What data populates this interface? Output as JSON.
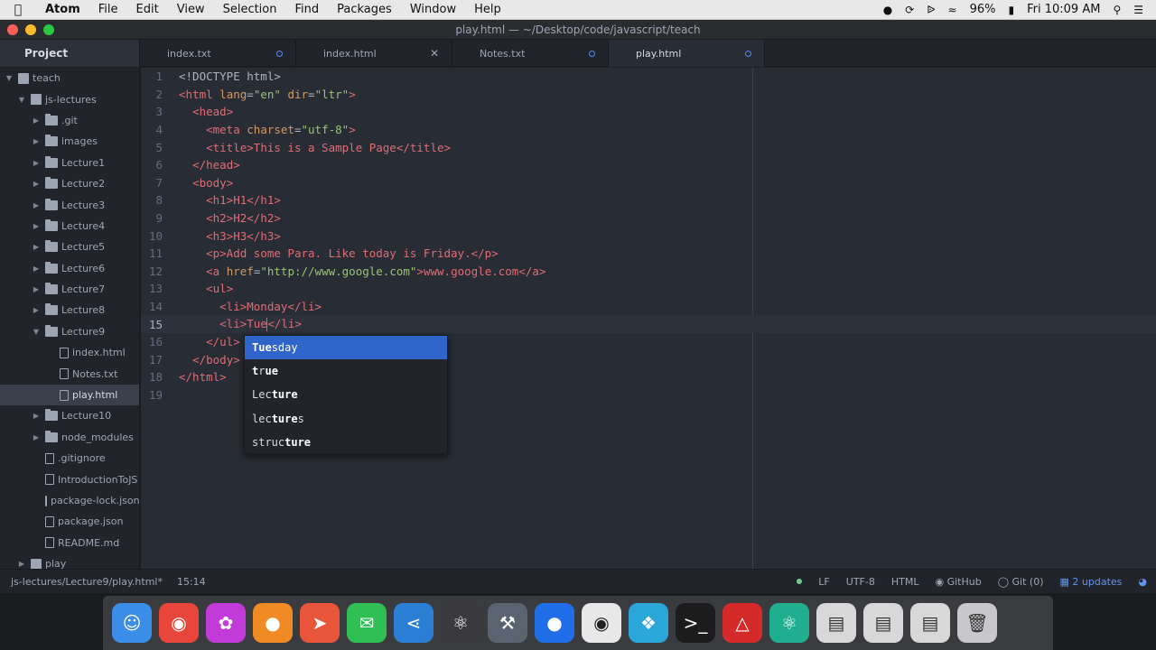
{
  "menubar": {
    "app_name": "Atom",
    "items": [
      "File",
      "Edit",
      "View",
      "Selection",
      "Find",
      "Packages",
      "Window",
      "Help"
    ],
    "battery": "96%",
    "clock": "Fri 10:09 AM"
  },
  "window": {
    "title": "play.html — ~/Desktop/code/javascript/teach"
  },
  "tabs": {
    "project_label": "Project",
    "items": [
      {
        "label": "index.txt"
      },
      {
        "label": "index.html"
      },
      {
        "label": "Notes.txt"
      },
      {
        "label": "play.html"
      }
    ]
  },
  "sidebar": {
    "items": [
      {
        "label": "teach"
      },
      {
        "label": "js-lectures"
      },
      {
        "label": ".git"
      },
      {
        "label": "images"
      },
      {
        "label": "Lecture1"
      },
      {
        "label": "Lecture2"
      },
      {
        "label": "Lecture3"
      },
      {
        "label": "Lecture4"
      },
      {
        "label": "Lecture5"
      },
      {
        "label": "Lecture6"
      },
      {
        "label": "Lecture7"
      },
      {
        "label": "Lecture8"
      },
      {
        "label": "Lecture9"
      },
      {
        "label": "index.html"
      },
      {
        "label": "Notes.txt"
      },
      {
        "label": "play.html"
      },
      {
        "label": "Lecture10"
      },
      {
        "label": "node_modules"
      },
      {
        "label": ".gitignore"
      },
      {
        "label": "IntroductionToJS"
      },
      {
        "label": "package-lock.json"
      },
      {
        "label": "package.json"
      },
      {
        "label": "README.md"
      },
      {
        "label": "play"
      }
    ]
  },
  "editor": {
    "line_numbers": [
      "1",
      "2",
      "3",
      "4",
      "5",
      "6",
      "7",
      "8",
      "9",
      "10",
      "11",
      "12",
      "13",
      "14",
      "15",
      "16",
      "17",
      "18",
      "19"
    ],
    "code": {
      "l1": "<!DOCTYPE html>",
      "l2_open": "<html",
      "l2_lang": "lang",
      "l2_lang_val": "\"en\"",
      "l2_dir": "dir",
      "l2_dir_val": "\"ltr\"",
      "l3": "<head>",
      "l4_open": "<meta",
      "l4_charset": "charset",
      "l4_charset_val": "\"utf-8\"",
      "l4_close": ">",
      "l5": "<title>This is a Sample Page</title>",
      "l6": "</head>",
      "l7": "<body>",
      "l8": "<h1>H1</h1>",
      "l9": "<h2>H2</h2>",
      "l10": "<h3>H3</h3>",
      "l11": "<p>Add some Para. Like today is Friday.</p>",
      "l12_open": "<a",
      "l12_href": "href",
      "l12_href_val": "\"http://www.google.com\"",
      "l12_rest": ">www.google.com</a>",
      "l13": "<ul>",
      "l14": "<li>Monday</li>",
      "l15_before": "<li>Tue",
      "l15_after": "</li>",
      "l16": "</ul>",
      "l17": "</body>",
      "l18": "</html>"
    }
  },
  "autocomplete": {
    "items": [
      {
        "match": "Tue",
        "rest": "sday"
      },
      {
        "match": "t",
        "mid": "r",
        "match2": "ue",
        "rest": ""
      },
      {
        "pre": "Lec",
        "match": "ture",
        "rest": ""
      },
      {
        "pre": "lec",
        "match": "ture",
        "rest": "s"
      },
      {
        "pre": "struc",
        "match": "ture",
        "rest": ""
      }
    ]
  },
  "statusbar": {
    "path": "js-lectures/Lecture9/play.html*",
    "position": "15:14",
    "line_ending": "LF",
    "encoding": "UTF-8",
    "grammar": "HTML",
    "github": "GitHub",
    "git": "Git (0)",
    "updates": "2 updates"
  }
}
